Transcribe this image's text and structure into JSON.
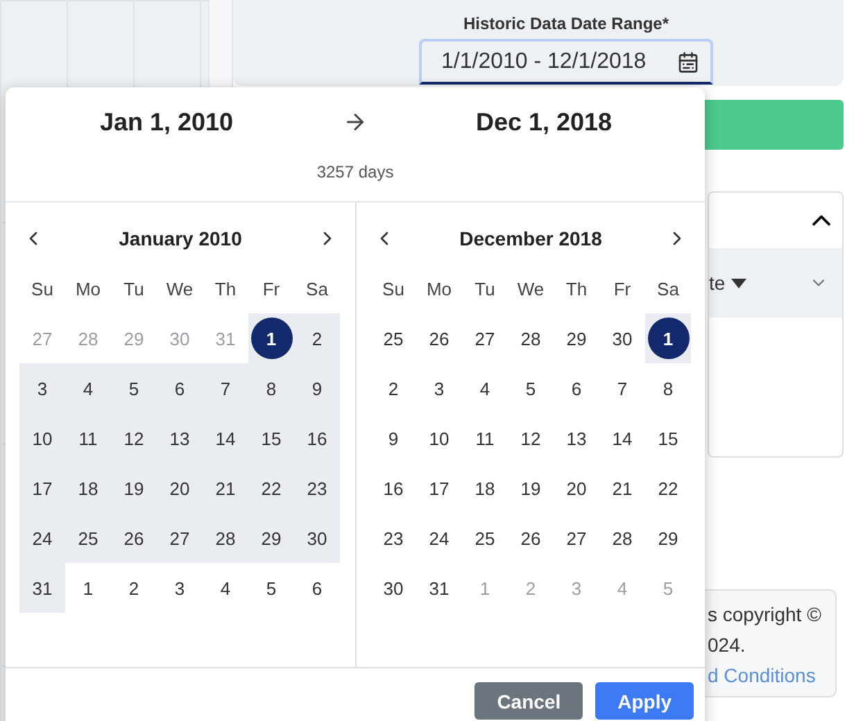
{
  "field": {
    "label": "Historic Data Date Range*",
    "value": "1/1/2010 - 12/1/2018"
  },
  "card": {
    "column_header": "te",
    "expanded": true
  },
  "note": {
    "lines": [
      "s copyright ©",
      "024."
    ],
    "link": "d Conditions"
  },
  "picker": {
    "start": "Jan 1, 2010",
    "end": "Dec 1, 2018",
    "duration": "3257 days",
    "months": [
      {
        "title": "January 2010",
        "weekdays": [
          "Su",
          "Mo",
          "Tu",
          "We",
          "Th",
          "Fr",
          "Sa"
        ],
        "days": [
          {
            "label": "27",
            "muted": true,
            "in_range": false,
            "selected": false
          },
          {
            "label": "28",
            "muted": true,
            "in_range": false,
            "selected": false
          },
          {
            "label": "29",
            "muted": true,
            "in_range": false,
            "selected": false
          },
          {
            "label": "30",
            "muted": true,
            "in_range": false,
            "selected": false
          },
          {
            "label": "31",
            "muted": true,
            "in_range": false,
            "selected": false
          },
          {
            "label": "1",
            "muted": false,
            "in_range": true,
            "selected": true
          },
          {
            "label": "2",
            "muted": false,
            "in_range": true,
            "selected": false
          },
          {
            "label": "3",
            "muted": false,
            "in_range": true,
            "selected": false
          },
          {
            "label": "4",
            "muted": false,
            "in_range": true,
            "selected": false
          },
          {
            "label": "5",
            "muted": false,
            "in_range": true,
            "selected": false
          },
          {
            "label": "6",
            "muted": false,
            "in_range": true,
            "selected": false
          },
          {
            "label": "7",
            "muted": false,
            "in_range": true,
            "selected": false
          },
          {
            "label": "8",
            "muted": false,
            "in_range": true,
            "selected": false
          },
          {
            "label": "9",
            "muted": false,
            "in_range": true,
            "selected": false
          },
          {
            "label": "10",
            "muted": false,
            "in_range": true,
            "selected": false
          },
          {
            "label": "11",
            "muted": false,
            "in_range": true,
            "selected": false
          },
          {
            "label": "12",
            "muted": false,
            "in_range": true,
            "selected": false
          },
          {
            "label": "13",
            "muted": false,
            "in_range": true,
            "selected": false
          },
          {
            "label": "14",
            "muted": false,
            "in_range": true,
            "selected": false
          },
          {
            "label": "15",
            "muted": false,
            "in_range": true,
            "selected": false
          },
          {
            "label": "16",
            "muted": false,
            "in_range": true,
            "selected": false
          },
          {
            "label": "17",
            "muted": false,
            "in_range": true,
            "selected": false
          },
          {
            "label": "18",
            "muted": false,
            "in_range": true,
            "selected": false
          },
          {
            "label": "19",
            "muted": false,
            "in_range": true,
            "selected": false
          },
          {
            "label": "20",
            "muted": false,
            "in_range": true,
            "selected": false
          },
          {
            "label": "21",
            "muted": false,
            "in_range": true,
            "selected": false
          },
          {
            "label": "22",
            "muted": false,
            "in_range": true,
            "selected": false
          },
          {
            "label": "23",
            "muted": false,
            "in_range": true,
            "selected": false
          },
          {
            "label": "24",
            "muted": false,
            "in_range": true,
            "selected": false
          },
          {
            "label": "25",
            "muted": false,
            "in_range": true,
            "selected": false
          },
          {
            "label": "26",
            "muted": false,
            "in_range": true,
            "selected": false
          },
          {
            "label": "27",
            "muted": false,
            "in_range": true,
            "selected": false
          },
          {
            "label": "28",
            "muted": false,
            "in_range": true,
            "selected": false
          },
          {
            "label": "29",
            "muted": false,
            "in_range": true,
            "selected": false
          },
          {
            "label": "30",
            "muted": false,
            "in_range": true,
            "selected": false
          },
          {
            "label": "31",
            "muted": false,
            "in_range": true,
            "selected": false
          },
          {
            "label": "1",
            "muted": false,
            "in_range": false,
            "selected": false
          },
          {
            "label": "2",
            "muted": false,
            "in_range": false,
            "selected": false
          },
          {
            "label": "3",
            "muted": false,
            "in_range": false,
            "selected": false
          },
          {
            "label": "4",
            "muted": false,
            "in_range": false,
            "selected": false
          },
          {
            "label": "5",
            "muted": false,
            "in_range": false,
            "selected": false
          },
          {
            "label": "6",
            "muted": false,
            "in_range": false,
            "selected": false
          }
        ]
      },
      {
        "title": "December 2018",
        "weekdays": [
          "Su",
          "Mo",
          "Tu",
          "We",
          "Th",
          "Fr",
          "Sa"
        ],
        "days": [
          {
            "label": "25",
            "muted": false,
            "in_range": false,
            "selected": false
          },
          {
            "label": "26",
            "muted": false,
            "in_range": false,
            "selected": false
          },
          {
            "label": "27",
            "muted": false,
            "in_range": false,
            "selected": false
          },
          {
            "label": "28",
            "muted": false,
            "in_range": false,
            "selected": false
          },
          {
            "label": "29",
            "muted": false,
            "in_range": false,
            "selected": false
          },
          {
            "label": "30",
            "muted": false,
            "in_range": false,
            "selected": false
          },
          {
            "label": "1",
            "muted": false,
            "in_range": true,
            "selected": true
          },
          {
            "label": "2",
            "muted": false,
            "in_range": false,
            "selected": false
          },
          {
            "label": "3",
            "muted": false,
            "in_range": false,
            "selected": false
          },
          {
            "label": "4",
            "muted": false,
            "in_range": false,
            "selected": false
          },
          {
            "label": "5",
            "muted": false,
            "in_range": false,
            "selected": false
          },
          {
            "label": "6",
            "muted": false,
            "in_range": false,
            "selected": false
          },
          {
            "label": "7",
            "muted": false,
            "in_range": false,
            "selected": false
          },
          {
            "label": "8",
            "muted": false,
            "in_range": false,
            "selected": false
          },
          {
            "label": "9",
            "muted": false,
            "in_range": false,
            "selected": false
          },
          {
            "label": "10",
            "muted": false,
            "in_range": false,
            "selected": false
          },
          {
            "label": "11",
            "muted": false,
            "in_range": false,
            "selected": false
          },
          {
            "label": "12",
            "muted": false,
            "in_range": false,
            "selected": false
          },
          {
            "label": "13",
            "muted": false,
            "in_range": false,
            "selected": false
          },
          {
            "label": "14",
            "muted": false,
            "in_range": false,
            "selected": false
          },
          {
            "label": "15",
            "muted": false,
            "in_range": false,
            "selected": false
          },
          {
            "label": "16",
            "muted": false,
            "in_range": false,
            "selected": false
          },
          {
            "label": "17",
            "muted": false,
            "in_range": false,
            "selected": false
          },
          {
            "label": "18",
            "muted": false,
            "in_range": false,
            "selected": false
          },
          {
            "label": "19",
            "muted": false,
            "in_range": false,
            "selected": false
          },
          {
            "label": "20",
            "muted": false,
            "in_range": false,
            "selected": false
          },
          {
            "label": "21",
            "muted": false,
            "in_range": false,
            "selected": false
          },
          {
            "label": "22",
            "muted": false,
            "in_range": false,
            "selected": false
          },
          {
            "label": "23",
            "muted": false,
            "in_range": false,
            "selected": false
          },
          {
            "label": "24",
            "muted": false,
            "in_range": false,
            "selected": false
          },
          {
            "label": "25",
            "muted": false,
            "in_range": false,
            "selected": false
          },
          {
            "label": "26",
            "muted": false,
            "in_range": false,
            "selected": false
          },
          {
            "label": "27",
            "muted": false,
            "in_range": false,
            "selected": false
          },
          {
            "label": "28",
            "muted": false,
            "in_range": false,
            "selected": false
          },
          {
            "label": "29",
            "muted": false,
            "in_range": false,
            "selected": false
          },
          {
            "label": "30",
            "muted": false,
            "in_range": false,
            "selected": false
          },
          {
            "label": "31",
            "muted": false,
            "in_range": false,
            "selected": false
          },
          {
            "label": "1",
            "muted": true,
            "in_range": false,
            "selected": false
          },
          {
            "label": "2",
            "muted": true,
            "in_range": false,
            "selected": false
          },
          {
            "label": "3",
            "muted": true,
            "in_range": false,
            "selected": false
          },
          {
            "label": "4",
            "muted": true,
            "in_range": false,
            "selected": false
          },
          {
            "label": "5",
            "muted": true,
            "in_range": false,
            "selected": false
          }
        ]
      }
    ],
    "buttons": [
      {
        "label": "Cancel",
        "kind": "secondary"
      },
      {
        "label": "Apply",
        "kind": "primary"
      }
    ]
  }
}
